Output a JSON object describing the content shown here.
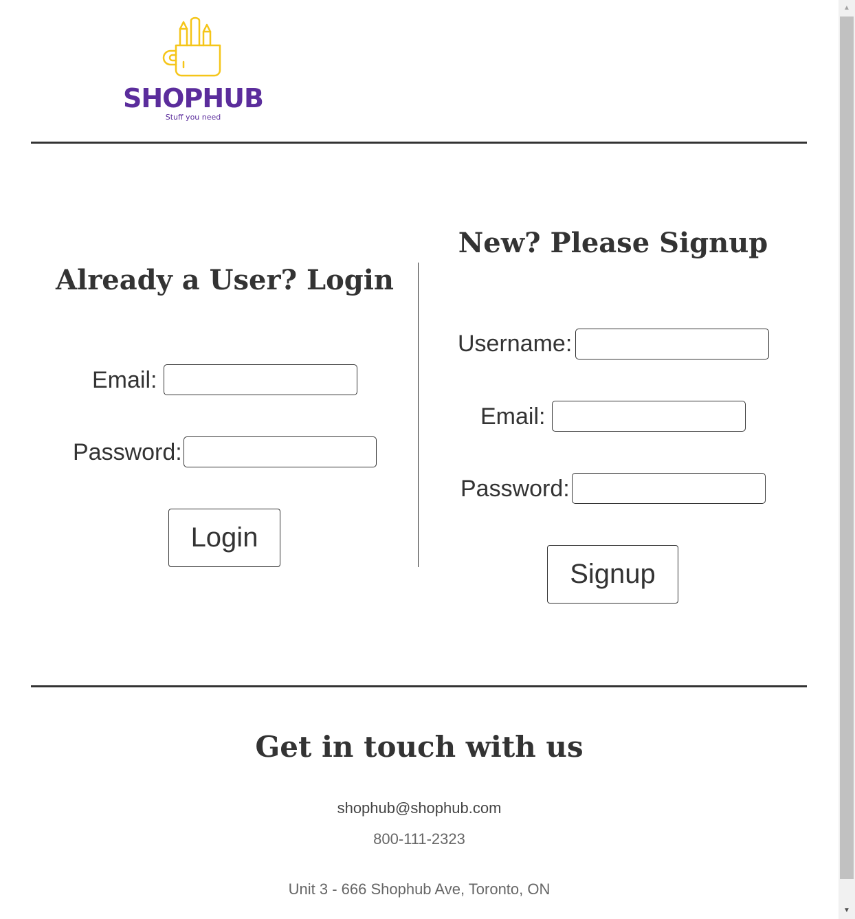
{
  "brand": {
    "name": "SHOPHUB",
    "tagline": "Stuff you need",
    "icon": "pencil-cup-icon",
    "primary_color": "#5b2d9c",
    "accent_color": "#f5c518"
  },
  "login": {
    "heading": "Already a User? Login",
    "email_label": "Email:",
    "email_value": "",
    "password_label": "Password:",
    "password_value": "",
    "button_label": "Login"
  },
  "signup": {
    "heading": "New? Please Signup",
    "username_label": "Username:",
    "username_value": "",
    "email_label": "Email:",
    "email_value": "",
    "password_label": "Password:",
    "password_value": "",
    "button_label": "Signup"
  },
  "contact": {
    "heading": "Get in touch with us",
    "email": "shophub@shophub.com",
    "phone": "800-111-2323",
    "address": "Unit 3 - 666 Shophub Ave, Toronto, ON"
  },
  "scrollbar": {
    "up_icon": "scroll-up-arrow-icon",
    "down_icon": "scroll-down-arrow-icon"
  }
}
